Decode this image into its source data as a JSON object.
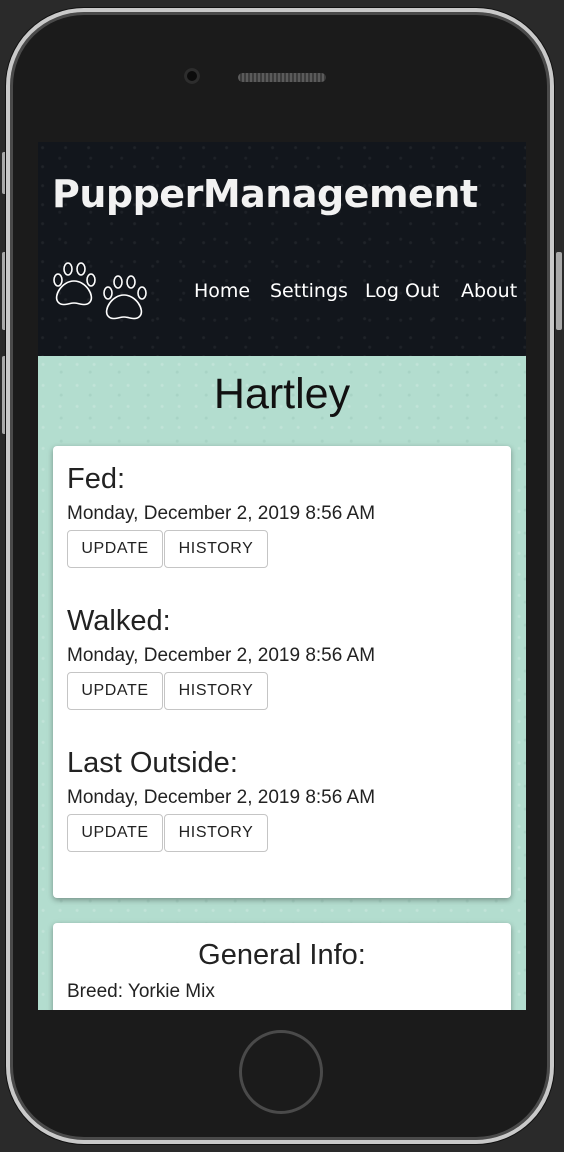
{
  "app": {
    "brand": "PupperManagement",
    "nav": [
      "Home",
      "Settings",
      "Log Out",
      "About"
    ]
  },
  "dog": {
    "name": "Hartley"
  },
  "entries": [
    {
      "label": "Fed:",
      "time": "Monday, December 2, 2019 8:56 AM",
      "update_label": "UPDATE",
      "history_label": "HISTORY"
    },
    {
      "label": "Walked:",
      "time": "Monday, December 2, 2019 8:56 AM",
      "update_label": "UPDATE",
      "history_label": "HISTORY"
    },
    {
      "label": "Last Outside:",
      "time": "Monday, December 2, 2019 8:56 AM",
      "update_label": "UPDATE",
      "history_label": "HISTORY"
    }
  ],
  "general_info": {
    "title": "General Info:",
    "breed_line": "Breed: Yorkie Mix"
  },
  "colors": {
    "header_bg": "#12161c",
    "content_bg": "#b3ddcf",
    "card_bg": "#ffffff"
  },
  "icons": {
    "logo": "paw-prints-icon"
  }
}
